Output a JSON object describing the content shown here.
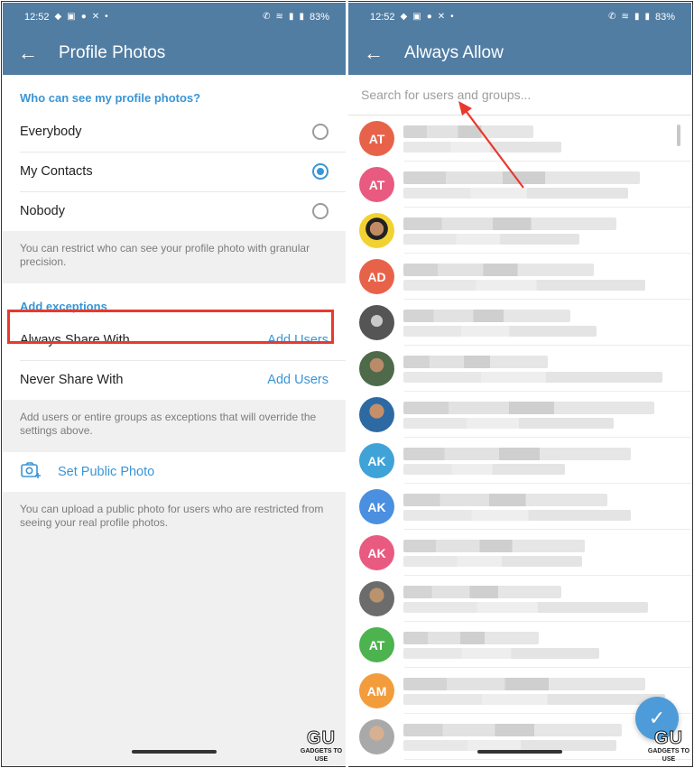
{
  "status": {
    "time": "12:52",
    "battery": "83%",
    "left_icons": [
      "chat-icon",
      "youtube-icon",
      "whatsapp-icon",
      "x-icon",
      "dot"
    ],
    "right_icons": [
      "wifi-call-icon",
      "wifi-icon",
      "signal-icon",
      "battery-icon"
    ]
  },
  "left": {
    "title": "Profile Photos",
    "who_header": "Who can see my profile photos?",
    "options": [
      {
        "label": "Everybody",
        "selected": false
      },
      {
        "label": "My Contacts",
        "selected": true
      },
      {
        "label": "Nobody",
        "selected": false
      }
    ],
    "restrict_info": "You can restrict who can see your profile photo with granular precision.",
    "exceptions_header": "Add exceptions",
    "always_label": "Always Share With",
    "always_action": "Add Users",
    "never_label": "Never Share With",
    "never_action": "Add Users",
    "exceptions_info": "Add users or entire groups as exceptions that will override the settings above.",
    "public_photo_label": "Set Public Photo",
    "public_info": "You can upload a public photo for users who are restricted from seeing your real profile photos."
  },
  "right": {
    "title": "Always Allow",
    "search_placeholder": "Search for users and groups...",
    "contacts": [
      {
        "initials": "AT",
        "color": "#e8624a",
        "photo": ""
      },
      {
        "initials": "AT",
        "color": "#e85a7f",
        "photo": ""
      },
      {
        "initials": "",
        "color": "",
        "photo": "yellow"
      },
      {
        "initials": "AD",
        "color": "#e8624a",
        "photo": ""
      },
      {
        "initials": "",
        "color": "",
        "photo": "bw"
      },
      {
        "initials": "",
        "color": "",
        "photo": "green"
      },
      {
        "initials": "",
        "color": "",
        "photo": "blue"
      },
      {
        "initials": "AK",
        "color": "#3fa3d8",
        "photo": ""
      },
      {
        "initials": "AK",
        "color": "#4a8fe0",
        "photo": ""
      },
      {
        "initials": "AK",
        "color": "#e85a7f",
        "photo": ""
      },
      {
        "initials": "",
        "color": "",
        "photo": "grey"
      },
      {
        "initials": "AT",
        "color": "#4cb34f",
        "photo": ""
      },
      {
        "initials": "AM",
        "color": "#f39c3c",
        "photo": ""
      },
      {
        "initials": "",
        "color": "",
        "photo": "light"
      }
    ],
    "fab_icon": "check-icon"
  },
  "watermark": {
    "logo": "GU",
    "text": "GADGETS TO USE"
  },
  "colors": {
    "appbar": "#527da3",
    "accent": "#3a95d5",
    "highlight": "#e8392e"
  }
}
